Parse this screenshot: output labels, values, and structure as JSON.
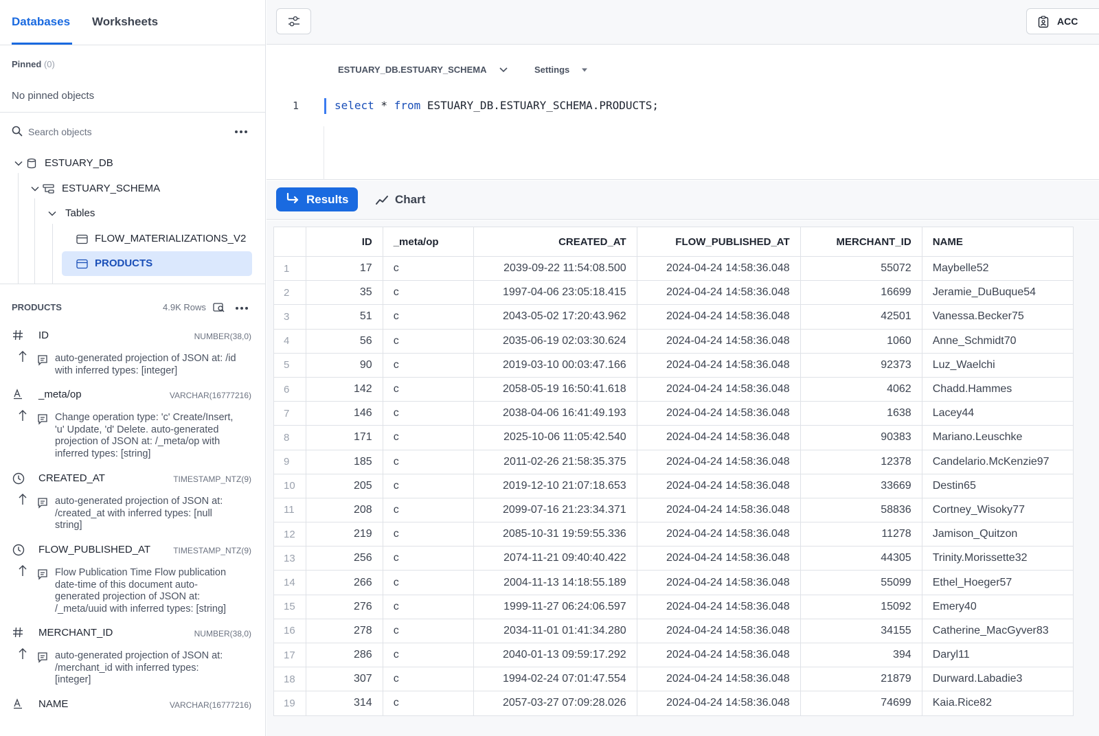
{
  "tabs": {
    "databases": "Databases",
    "worksheets": "Worksheets"
  },
  "pinned": {
    "label": "Pinned",
    "count": "(0)",
    "empty": "No pinned objects"
  },
  "search": {
    "placeholder": "Search objects"
  },
  "tree": {
    "database": "ESTUARY_DB",
    "schema": "ESTUARY_SCHEMA",
    "folder": "Tables",
    "tables": [
      "FLOW_MATERIALIZATIONS_V2",
      "PRODUCTS"
    ]
  },
  "details": {
    "table": "PRODUCTS",
    "rows": "4.9K Rows",
    "columns": [
      {
        "name": "ID",
        "type": "NUMBER(38,0)",
        "icon": "hash-icon",
        "desc": [
          "auto-generated projection of JSON at: /id",
          "with inferred types: [integer]"
        ]
      },
      {
        "name": "_meta/op",
        "type": "VARCHAR(16777216)",
        "icon": "text-type-icon",
        "desc": [
          "Change operation type: 'c' Create/Insert,",
          "'u' Update, 'd' Delete. auto-generated",
          "projection of JSON at: /_meta/op with",
          "inferred types: [string]"
        ]
      },
      {
        "name": "CREATED_AT",
        "type": "TIMESTAMP_NTZ(9)",
        "icon": "clock-icon",
        "desc": [
          "auto-generated projection of JSON at:",
          "/created_at with inferred types: [null",
          "string]"
        ]
      },
      {
        "name": "FLOW_PUBLISHED_AT",
        "type": "TIMESTAMP_NTZ(9)",
        "icon": "clock-icon",
        "desc": [
          "Flow Publication Time Flow publication",
          "date-time of this document auto-",
          "generated projection of JSON at:",
          "/_meta/uuid with inferred types: [string]"
        ]
      },
      {
        "name": "MERCHANT_ID",
        "type": "NUMBER(38,0)",
        "icon": "hash-icon",
        "desc": [
          "auto-generated projection of JSON at:",
          "/merchant_id with inferred types:",
          "[integer]"
        ]
      },
      {
        "name": "NAME",
        "type": "VARCHAR(16777216)",
        "icon": "text-type-icon",
        "desc": []
      }
    ]
  },
  "toolbar": {
    "account_label": "ACC"
  },
  "editor": {
    "context": "ESTUARY_DB.ESTUARY_SCHEMA",
    "settings": "Settings",
    "line_number": "1",
    "code": {
      "kw1": "select",
      "mid": " * ",
      "kw2": "from",
      "rest": " ESTUARY_DB.ESTUARY_SCHEMA.PRODUCTS;"
    }
  },
  "results": {
    "results_label": "Results",
    "chart_label": "Chart",
    "headers": [
      "ID",
      "_meta/op",
      "CREATED_AT",
      "FLOW_PUBLISHED_AT",
      "MERCHANT_ID",
      "NAME"
    ],
    "rows": [
      [
        "1",
        "17",
        "c",
        "2039-09-22 11:54:08.500",
        "2024-04-24 14:58:36.048",
        "55072",
        "Maybelle52"
      ],
      [
        "2",
        "35",
        "c",
        "1997-04-06 23:05:18.415",
        "2024-04-24 14:58:36.048",
        "16699",
        "Jeramie_DuBuque54"
      ],
      [
        "3",
        "51",
        "c",
        "2043-05-02 17:20:43.962",
        "2024-04-24 14:58:36.048",
        "42501",
        "Vanessa.Becker75"
      ],
      [
        "4",
        "56",
        "c",
        "2035-06-19 02:03:30.624",
        "2024-04-24 14:58:36.048",
        "1060",
        "Anne_Schmidt70"
      ],
      [
        "5",
        "90",
        "c",
        "2019-03-10 00:03:47.166",
        "2024-04-24 14:58:36.048",
        "92373",
        "Luz_Waelchi"
      ],
      [
        "6",
        "142",
        "c",
        "2058-05-19 16:50:41.618",
        "2024-04-24 14:58:36.048",
        "4062",
        "Chadd.Hammes"
      ],
      [
        "7",
        "146",
        "c",
        "2038-04-06 16:41:49.193",
        "2024-04-24 14:58:36.048",
        "1638",
        "Lacey44"
      ],
      [
        "8",
        "171",
        "c",
        "2025-10-06 11:05:42.540",
        "2024-04-24 14:58:36.048",
        "90383",
        "Mariano.Leuschke"
      ],
      [
        "9",
        "185",
        "c",
        "2011-02-26 21:58:35.375",
        "2024-04-24 14:58:36.048",
        "12378",
        "Candelario.McKenzie97"
      ],
      [
        "10",
        "205",
        "c",
        "2019-12-10 21:07:18.653",
        "2024-04-24 14:58:36.048",
        "33669",
        "Destin65"
      ],
      [
        "11",
        "208",
        "c",
        "2099-07-16 21:23:34.371",
        "2024-04-24 14:58:36.048",
        "58836",
        "Cortney_Wisoky77"
      ],
      [
        "12",
        "219",
        "c",
        "2085-10-31 19:59:55.336",
        "2024-04-24 14:58:36.048",
        "11278",
        "Jamison_Quitzon"
      ],
      [
        "13",
        "256",
        "c",
        "2074-11-21 09:40:40.422",
        "2024-04-24 14:58:36.048",
        "44305",
        "Trinity.Morissette32"
      ],
      [
        "14",
        "266",
        "c",
        "2004-11-13 14:18:55.189",
        "2024-04-24 14:58:36.048",
        "55099",
        "Ethel_Hoeger57"
      ],
      [
        "15",
        "276",
        "c",
        "1999-11-27 06:24:06.597",
        "2024-04-24 14:58:36.048",
        "15092",
        "Emery40"
      ],
      [
        "16",
        "278",
        "c",
        "2034-11-01 01:41:34.280",
        "2024-04-24 14:58:36.048",
        "34155",
        "Catherine_MacGyver83"
      ],
      [
        "17",
        "286",
        "c",
        "2040-01-13 09:59:17.292",
        "2024-04-24 14:58:36.048",
        "394",
        "Daryl11"
      ],
      [
        "18",
        "307",
        "c",
        "1994-02-24 07:01:47.554",
        "2024-04-24 14:58:36.048",
        "21879",
        "Durward.Labadie3"
      ],
      [
        "19",
        "314",
        "c",
        "2057-03-27 07:09:28.026",
        "2024-04-24 14:58:36.048",
        "74699",
        "Kaia.Rice82"
      ]
    ]
  }
}
